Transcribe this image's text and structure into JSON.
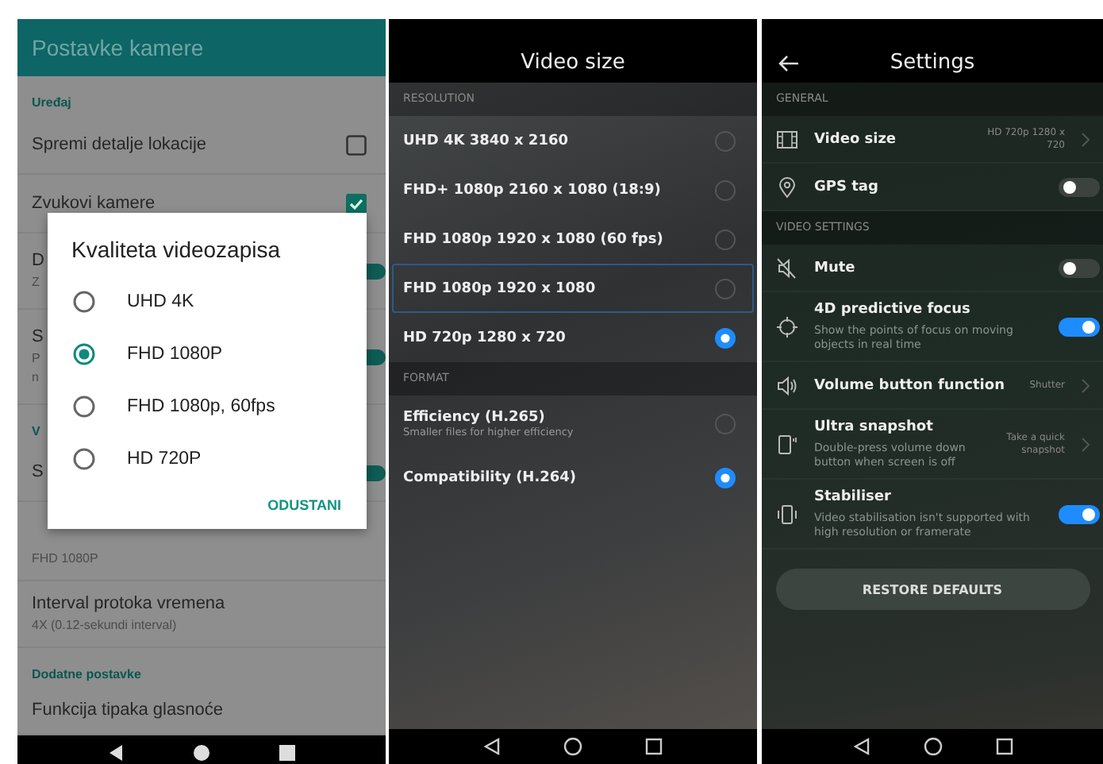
{
  "camera_settings": {
    "title": "Postavke kamere",
    "items": [
      {
        "kind": "section",
        "label": "Uređaj"
      },
      {
        "kind": "checkbox",
        "title": "Spremi detalje lokacije",
        "checked": false
      },
      {
        "kind": "checkbox",
        "title": "Zvukovi kamere",
        "checked": true
      },
      {
        "kind": "switch",
        "title": "D",
        "subtitle_lines": [
          "Z"
        ],
        "on": true
      },
      {
        "kind": "switch",
        "title": "S",
        "subtitle_lines": [
          "P",
          "n"
        ],
        "on": true
      },
      {
        "kind": "section",
        "label": "V"
      },
      {
        "kind": "switch",
        "title": "S",
        "on": true
      },
      {
        "kind": "detail",
        "subtitle_lines": [
          "FHD 1080P"
        ]
      },
      {
        "kind": "detail",
        "title": "Interval protoka vremena",
        "subtitle_lines": [
          "4X (0.12-sekundi interval)"
        ]
      },
      {
        "kind": "section",
        "label": "Dodatne postavke"
      },
      {
        "kind": "detail",
        "title": "Funkcija tipaka glasnoće"
      }
    ],
    "dialog": {
      "title": "Kvaliteta videozapisa",
      "options": [
        {
          "label": "UHD 4K",
          "selected": false
        },
        {
          "label": "FHD 1080P",
          "selected": true
        },
        {
          "label": "FHD 1080p, 60fps",
          "selected": false
        },
        {
          "label": "HD 720P",
          "selected": false
        }
      ],
      "button": "ODUSTANI"
    }
  },
  "video_size": {
    "title": "Video size",
    "sections": [
      {
        "header": "RESOLUTION",
        "options": [
          {
            "label": "UHD 4K 3840 x 2160",
            "selected": false,
            "focused": false
          },
          {
            "label": "FHD+ 1080p 2160 x 1080 (18:9)",
            "selected": false,
            "focused": false
          },
          {
            "label": "FHD 1080p 1920 x 1080 (60 fps)",
            "selected": false,
            "focused": false
          },
          {
            "label": "FHD 1080p 1920 x 1080",
            "selected": false,
            "focused": true
          },
          {
            "label": "HD 720p 1280 x 720",
            "selected": true,
            "focused": false
          }
        ]
      },
      {
        "header": "FORMAT",
        "options": [
          {
            "label": "Efficiency (H.265)",
            "sublabel": "Smaller files for higher efficiency",
            "selected": false,
            "focused": false
          },
          {
            "label": "Compatibility (H.264)",
            "selected": true,
            "focused": false
          }
        ]
      }
    ]
  },
  "settings": {
    "title": "Settings",
    "sections": [
      {
        "header": "GENERAL",
        "items": [
          {
            "kind": "link",
            "title": "Video size",
            "value": "HD 720p 1280 x 720"
          },
          {
            "kind": "switch",
            "title": "GPS tag",
            "on": false
          }
        ]
      },
      {
        "header": "VIDEO SETTINGS",
        "items": [
          {
            "kind": "switch",
            "title": "Mute",
            "on": false
          },
          {
            "kind": "switch",
            "title": "4D predictive focus",
            "description": "Show the points of focus on moving objects in real time",
            "on": true
          },
          {
            "kind": "link",
            "title": "Volume button function",
            "value": "Shutter"
          },
          {
            "kind": "link",
            "title": "Ultra snapshot",
            "description": "Double-press volume down button when screen is off",
            "value": "Take a quick snapshot"
          },
          {
            "kind": "switch",
            "title": "Stabiliser",
            "description": "Video stabilisation isn't supported with high resolution or framerate",
            "on": true
          }
        ]
      }
    ],
    "button": "RESTORE DEFAULTS"
  }
}
